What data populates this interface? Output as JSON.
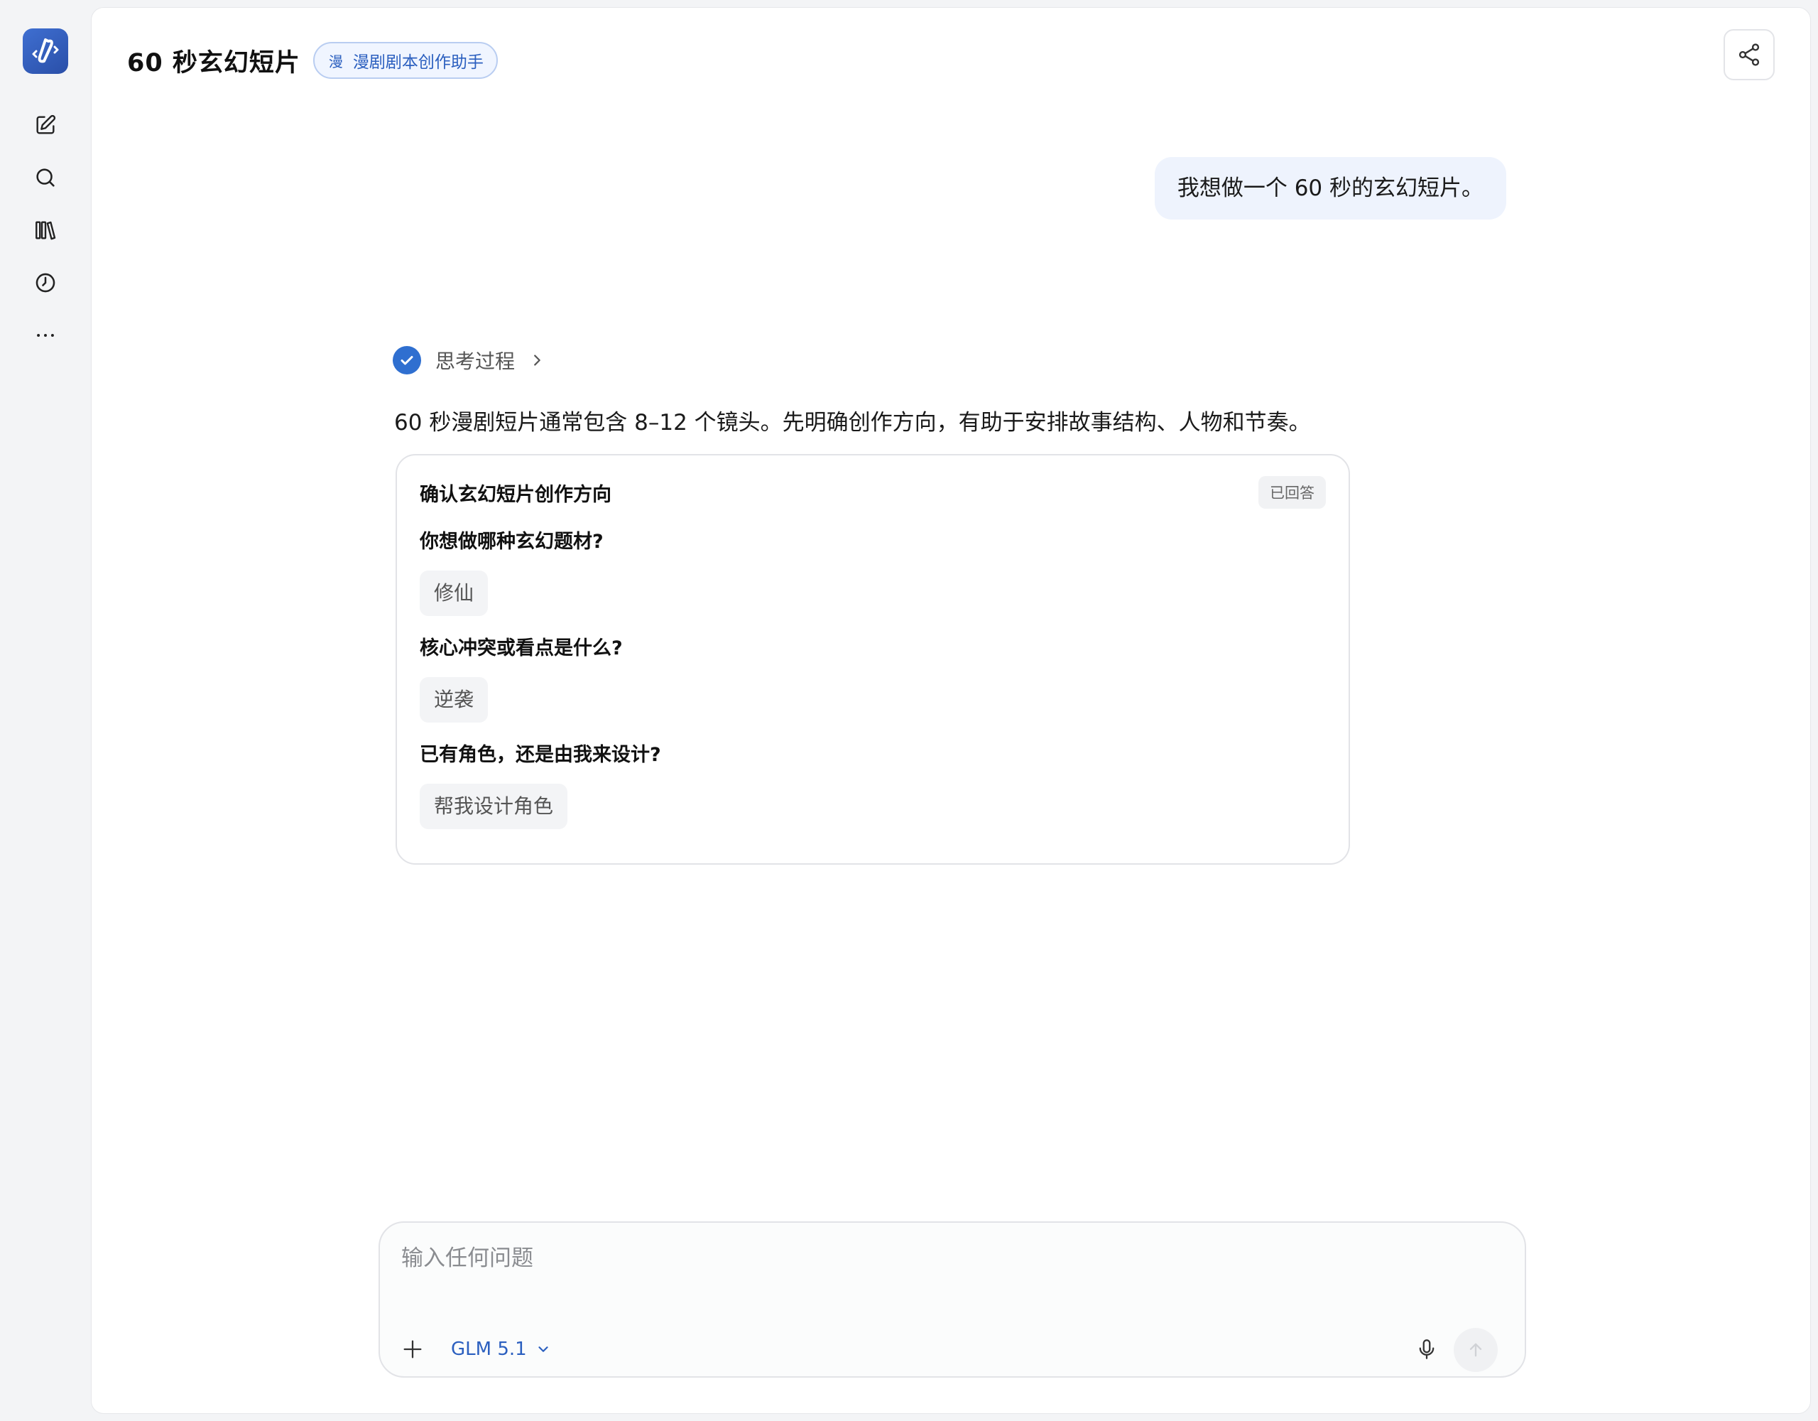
{
  "sidebar": {
    "logo_icon": "app-logo-icon",
    "nav": [
      {
        "name": "new-chat-icon"
      },
      {
        "name": "search-icon"
      },
      {
        "name": "library-icon"
      },
      {
        "name": "history-icon"
      },
      {
        "name": "more-icon"
      }
    ]
  },
  "header": {
    "title": "60 秒玄幻短片",
    "agent_badge_char": "漫",
    "agent_badge_label": "漫剧剧本创作助手",
    "share_icon": "share-icon"
  },
  "conversation": {
    "user_message": "我想做一个 60 秒的玄幻短片。",
    "thinking_label": "思考过程",
    "assistant_text": "60 秒漫剧短片通常包含 8–12 个镜头。先明确创作方向，有助于安排故事结构、人物和节奏。",
    "card": {
      "title": "确认玄幻短片创作方向",
      "status": "已回答",
      "items": [
        {
          "question": "你想做哪种玄幻题材?",
          "answer": "修仙"
        },
        {
          "question": "核心冲突或看点是什么?",
          "answer": "逆袭"
        },
        {
          "question": "已有角色，还是由我来设计?",
          "answer": "帮我设计角色"
        }
      ]
    }
  },
  "composer": {
    "placeholder": "输入任何问题",
    "model": "GLM 5.1"
  },
  "colors": {
    "accent": "#2f6fd0",
    "badge_bg": "#f0f5ff",
    "user_bubble_bg": "#eef3fd"
  }
}
